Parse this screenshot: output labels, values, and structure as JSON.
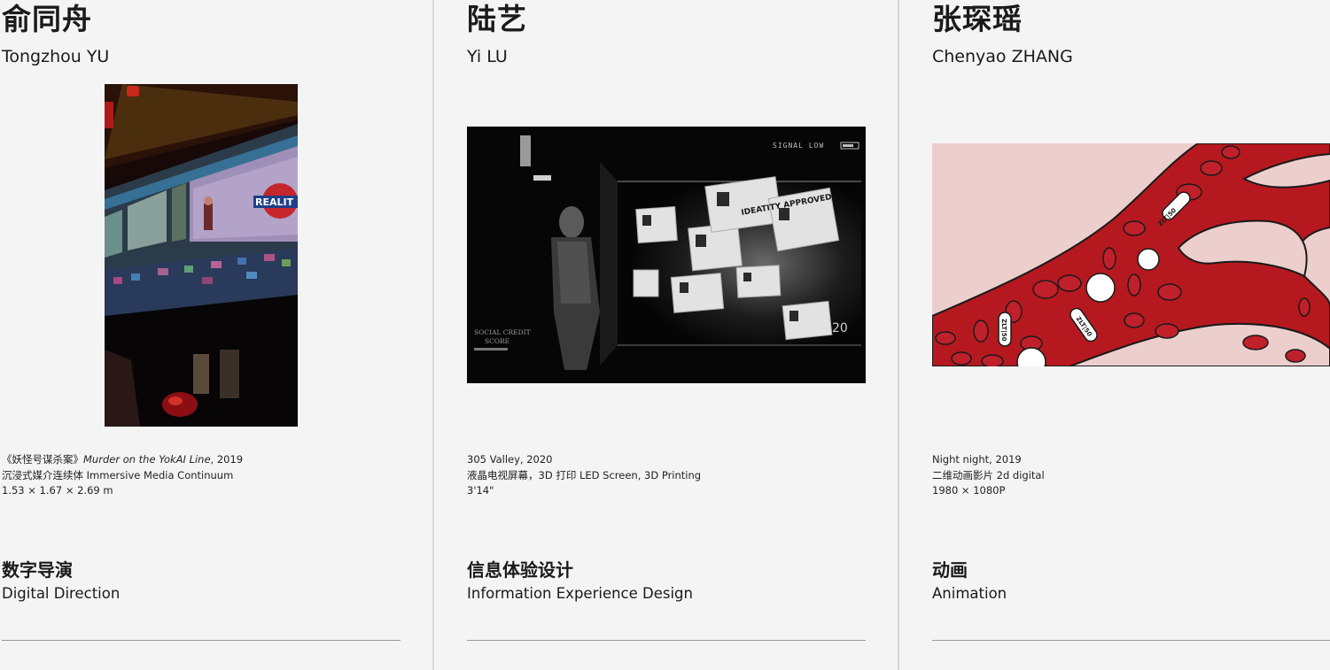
{
  "artists": [
    {
      "name_cn": "俞同舟",
      "name_en": "Tongzhou YU",
      "artwork_image": "subway-train-reality-station",
      "artwork_sign_text": "REALIT",
      "caption": {
        "title_cn": "《妖怪号谋杀案》",
        "title_en": "Murder on the YokAI Line",
        "year": ", 2019",
        "medium": "沉浸式媒介连续体  Immersive Media Continuum",
        "dimensions": "1.53 × 1.67 × 2.69 m"
      },
      "department_cn": "数字导演",
      "department_en": "Digital Direction"
    },
    {
      "name_cn": "陆艺",
      "name_en": "Yi LU",
      "artwork_image": "identity-approved-screens",
      "artwork_text": {
        "signal": "SIGNAL LOW",
        "credit_1": "SOCIAL CREDIT",
        "credit_2": "SCORE",
        "card_text": "IDEATITY APPROVED",
        "counter": "20"
      },
      "caption": {
        "line1": "305 Valley, 2020",
        "line2": "液晶电视屏幕，3D 打印  LED Screen, 3D Printing",
        "line3": "3'14\""
      },
      "department_cn": "信息体验设计",
      "department_en": "Information Experience Design"
    },
    {
      "name_cn": "张琛瑶",
      "name_en": "Chenyao ZHANG",
      "artwork_image": "red-blood-vessel-animation",
      "artwork_pill_text": "ZLT|50",
      "caption": {
        "line1": "Night night, 2019",
        "line2": "二维动画影片  2d digital",
        "line3": "1980 × 1080P"
      },
      "department_cn": "动画",
      "department_en": "Animation"
    }
  ],
  "colors": {
    "background": "#f4f4f4",
    "divider": "#d8d8d8",
    "rule": "#9a9a9a",
    "text": "#1a1a1a",
    "vessel_red": "#b5191f",
    "pink_bg": "#eccfcd"
  }
}
